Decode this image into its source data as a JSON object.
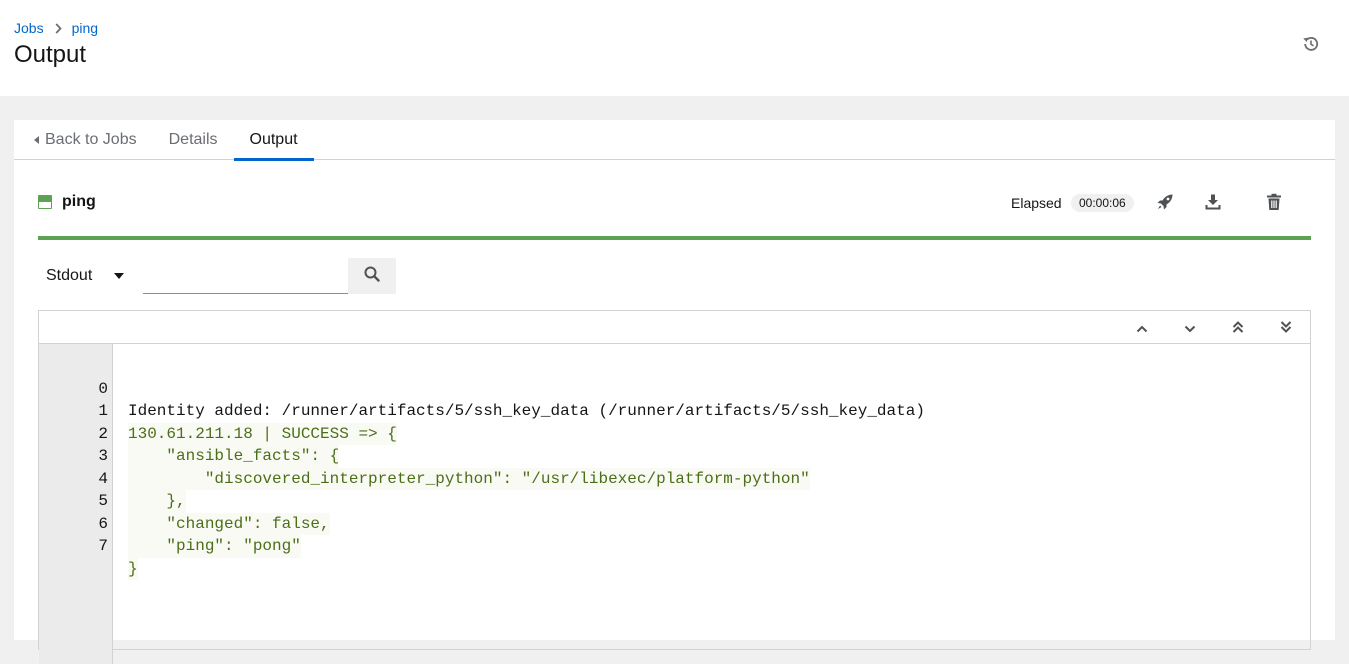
{
  "breadcrumb": {
    "root": "Jobs",
    "current": "ping"
  },
  "page": {
    "title": "Output"
  },
  "tabs": [
    {
      "label": "Back to Jobs"
    },
    {
      "label": "Details"
    },
    {
      "label": "Output"
    }
  ],
  "job": {
    "name": "ping",
    "status": "successful",
    "elapsed_label": "Elapsed",
    "elapsed_value": "00:00:06",
    "progress_percent": 100
  },
  "toolbar": {
    "filter_select": "Stdout",
    "search_placeholder": ""
  },
  "output": {
    "lines": [
      {
        "num": "0",
        "text": "Identity added: /runner/artifacts/5/ssh_key_data (/runner/artifacts/5/ssh_key_data)",
        "style": "plain"
      },
      {
        "num": "1",
        "text": "130.61.211.18 | SUCCESS => {",
        "style": "ok"
      },
      {
        "num": "2",
        "text": "    \"ansible_facts\": {",
        "style": "ok"
      },
      {
        "num": "3",
        "text": "        \"discovered_interpreter_python\": \"/usr/libexec/platform-python\"",
        "style": "ok"
      },
      {
        "num": "4",
        "text": "    },",
        "style": "ok"
      },
      {
        "num": "5",
        "text": "    \"changed\": false,",
        "style": "ok"
      },
      {
        "num": "6",
        "text": "    \"ping\": \"pong\"",
        "style": "ok"
      },
      {
        "num": "7",
        "text": "}",
        "style": "ok"
      }
    ]
  },
  "colors": {
    "link": "#0066cc",
    "success": "#5ba352",
    "ok_text": "#4b6f18"
  }
}
